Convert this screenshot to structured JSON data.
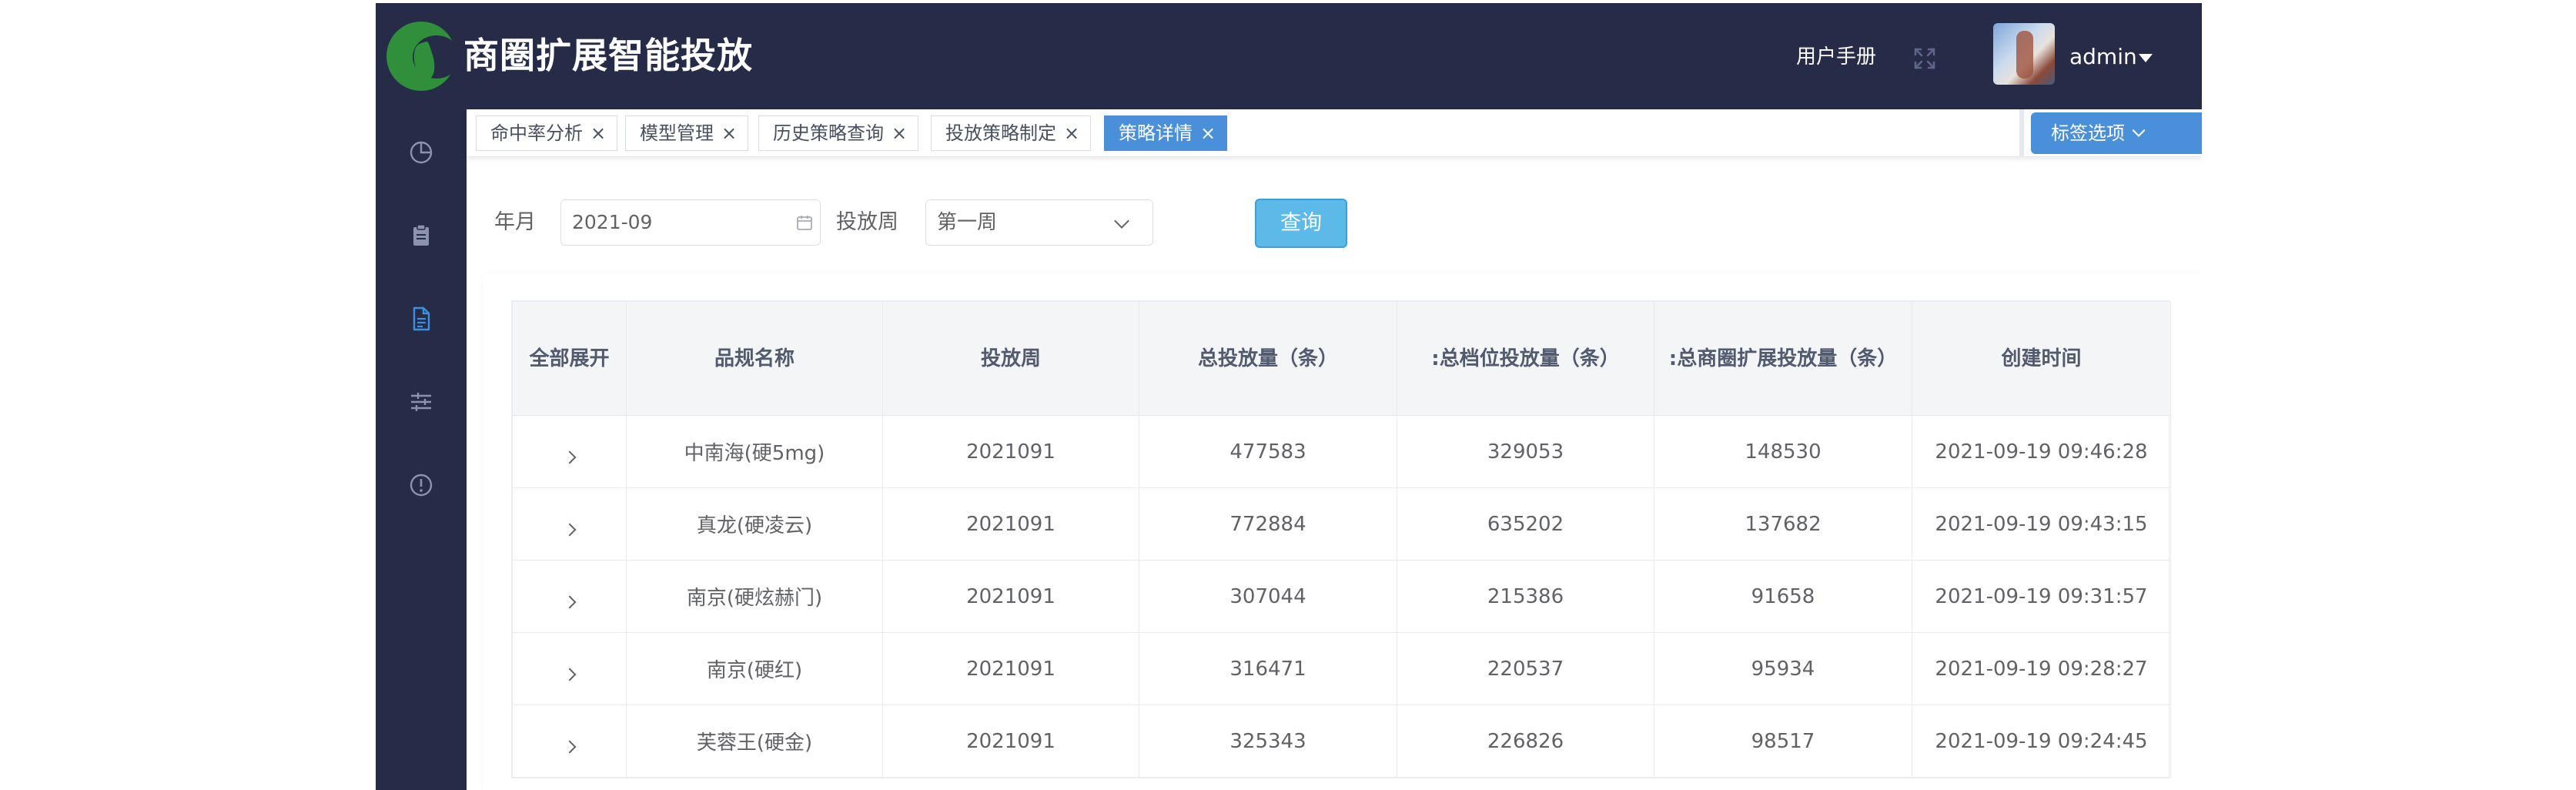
{
  "header": {
    "app_title": "商圈扩展智能投放",
    "user_manual": "用户手册",
    "username": "admin"
  },
  "sidebar": {
    "items": [
      {
        "icon": "pie-chart-icon"
      },
      {
        "icon": "clipboard-icon"
      },
      {
        "icon": "document-icon",
        "active": true
      },
      {
        "icon": "sliders-icon"
      },
      {
        "icon": "alert-circle-icon"
      }
    ]
  },
  "tags": {
    "items": [
      {
        "label": "命中率分析",
        "close": "×"
      },
      {
        "label": "模型管理",
        "close": "×"
      },
      {
        "label": "历史策略查询",
        "close": "×"
      },
      {
        "label": "投放策略制定",
        "close": "×"
      },
      {
        "label": "策略详情",
        "close": "×",
        "active": true
      }
    ],
    "options_label": "标签选项"
  },
  "filters": {
    "month_label": "年月",
    "month_value": "2021-09",
    "week_label": "投放周",
    "week_value": "第一周",
    "query_button": "查询"
  },
  "table": {
    "columns": [
      "全部展开",
      "品规名称",
      "投放周",
      "总投放量（条）",
      ":总档位投放量（条）",
      ":总商圈扩展投放量（条）",
      "创建时间"
    ],
    "rows": [
      {
        "name": "中南海(硬5mg)",
        "week": "2021091",
        "total": "477583",
        "tier_total": "329053",
        "area_total": "148530",
        "created": "2021-09-19 09:46:28"
      },
      {
        "name": "真龙(硬凌云)",
        "week": "2021091",
        "total": "772884",
        "tier_total": "635202",
        "area_total": "137682",
        "created": "2021-09-19 09:43:15"
      },
      {
        "name": "南京(硬炫赫门)",
        "week": "2021091",
        "total": "307044",
        "tier_total": "215386",
        "area_total": "91658",
        "created": "2021-09-19 09:31:57"
      },
      {
        "name": "南京(硬红)",
        "week": "2021091",
        "total": "316471",
        "tier_total": "220537",
        "area_total": "95934",
        "created": "2021-09-19 09:28:27"
      },
      {
        "name": "芙蓉王(硬金)",
        "week": "2021091",
        "total": "325343",
        "tier_total": "226826",
        "area_total": "98517",
        "created": "2021-09-19 09:24:45"
      }
    ]
  },
  "colors": {
    "nav_bg": "#262c48",
    "accent": "#4a8fd9",
    "query_button": "#5cb9e8",
    "logo_green": "#2f8f3a"
  }
}
